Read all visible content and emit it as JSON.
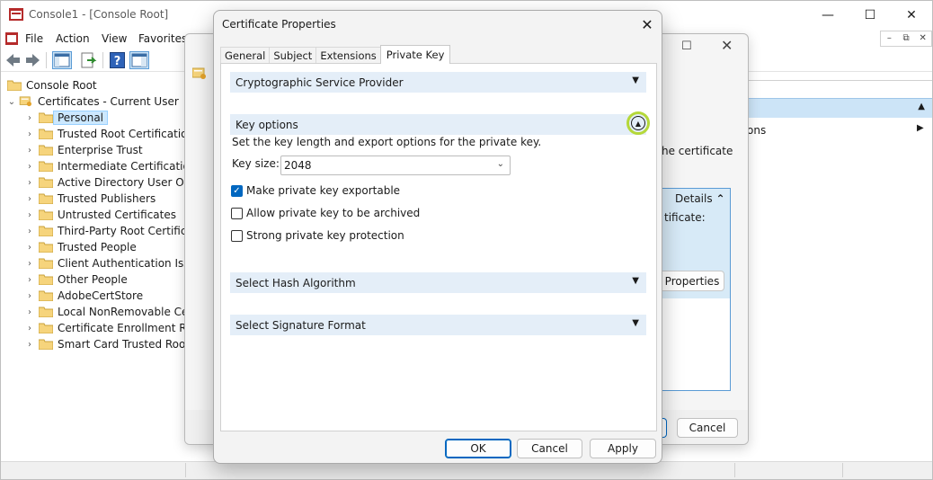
{
  "main_window": {
    "title": "Console1 - [Console Root]",
    "controls": {
      "minimize": "—",
      "maximize": "☐",
      "close": "✕"
    },
    "menu": [
      "File",
      "Action",
      "View",
      "Favorites"
    ],
    "mdi_controls": [
      "–",
      "⧉",
      "✕"
    ]
  },
  "tree": {
    "root": "Console Root",
    "store": "Certificates - Current User",
    "items": [
      "Personal",
      "Trusted Root Certification A",
      "Enterprise Trust",
      "Intermediate Certification A",
      "Active Directory User Objec",
      "Trusted Publishers",
      "Untrusted Certificates",
      "Third-Party Root Certificati",
      "Trusted People",
      "Client Authentication Issue",
      "Other People",
      "AdobeCertStore",
      "Local NonRemovable Certi",
      "Certificate Enrollment Requ",
      "Smart Card Trusted Roots"
    ],
    "selected_index": 0
  },
  "actions_pane": {
    "item_text": "ons",
    "item_arrow": "▶",
    "header_arrow": "▲"
  },
  "back_dialog": {
    "max_glyph": "☐",
    "close_glyph": "✕",
    "certificate_text": "he certificate",
    "details_label": "Details",
    "details_chevron": "⌃",
    "certificate_label": "tificate:",
    "properties_button": "Properties",
    "cancel_button": "Cancel"
  },
  "dialog": {
    "title": "Certificate Properties",
    "close_glyph": "✕",
    "tabs": [
      "General",
      "Subject",
      "Extensions",
      "Private Key"
    ],
    "active_tab": "Private Key",
    "sections": {
      "csp": "Cryptographic Service Provider",
      "key_options": "Key options",
      "hash": "Select Hash Algorithm",
      "signature": "Select Signature Format"
    },
    "key_options": {
      "description": "Set the key length and export options for the private key.",
      "key_size_label": "Key size:",
      "key_size_value": "2048",
      "checkboxes": [
        {
          "label": "Make private key exportable",
          "checked": true
        },
        {
          "label": "Allow private key to be archived",
          "checked": false
        },
        {
          "label": "Strong private key protection",
          "checked": false
        }
      ]
    },
    "buttons": {
      "ok": "OK",
      "cancel": "Cancel",
      "apply": "Apply"
    },
    "colors": {
      "accent": "#0067c0",
      "section_bg": "#e4eef8",
      "highlight_ring": "#b5d83a"
    }
  }
}
